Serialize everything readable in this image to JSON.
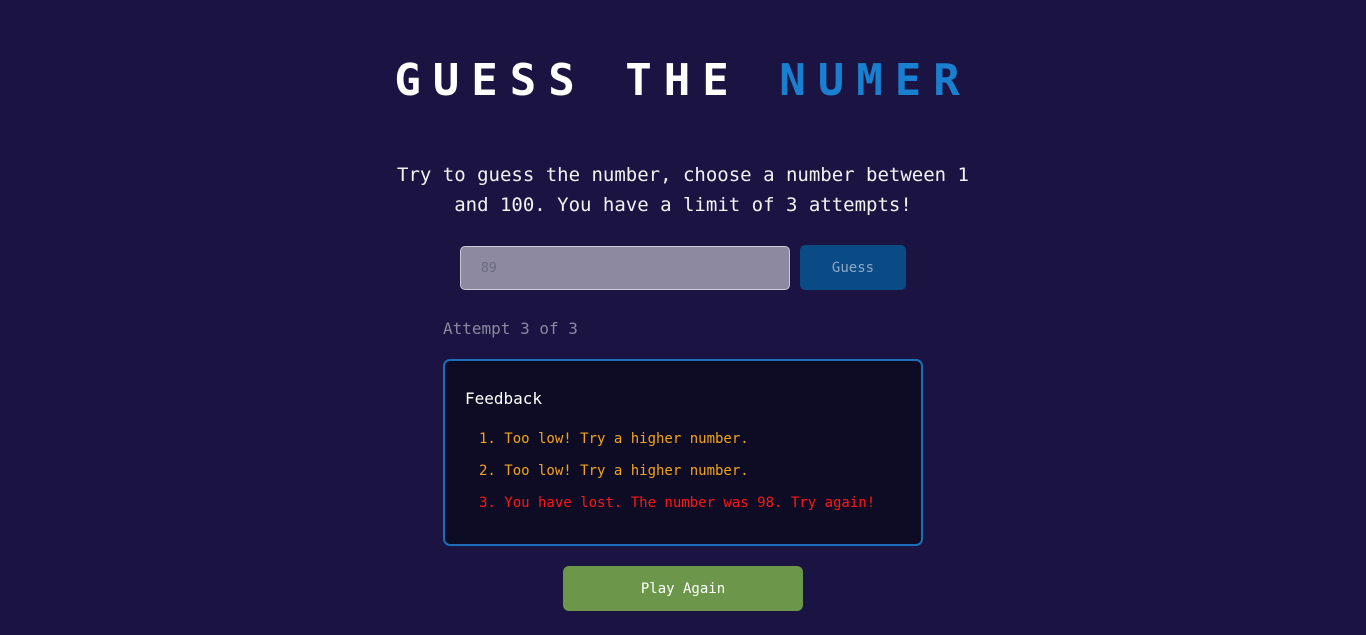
{
  "header": {
    "title_part1": "GUESS THE",
    "title_part2": "NUMER"
  },
  "intro": {
    "text": "Try to guess the number, choose a number between 1 and 100. You have a limit of 3 attempts!"
  },
  "guess_form": {
    "input_value": "89",
    "button_label": "Guess"
  },
  "attempt": {
    "text": "Attempt 3 of 3"
  },
  "feedback": {
    "title": "Feedback",
    "items": [
      "1. Too low! Try a higher number.",
      "2. Too low! Try a higher number.",
      "3. You have lost. The number was 98. Try again!"
    ]
  },
  "actions": {
    "play_again_label": "Play Again"
  },
  "colors": {
    "background": "#1b1442",
    "accent_blue": "#1b7fd0",
    "warning": "#f2a31b",
    "error": "#ff1515",
    "success_button": "#6c974a"
  }
}
